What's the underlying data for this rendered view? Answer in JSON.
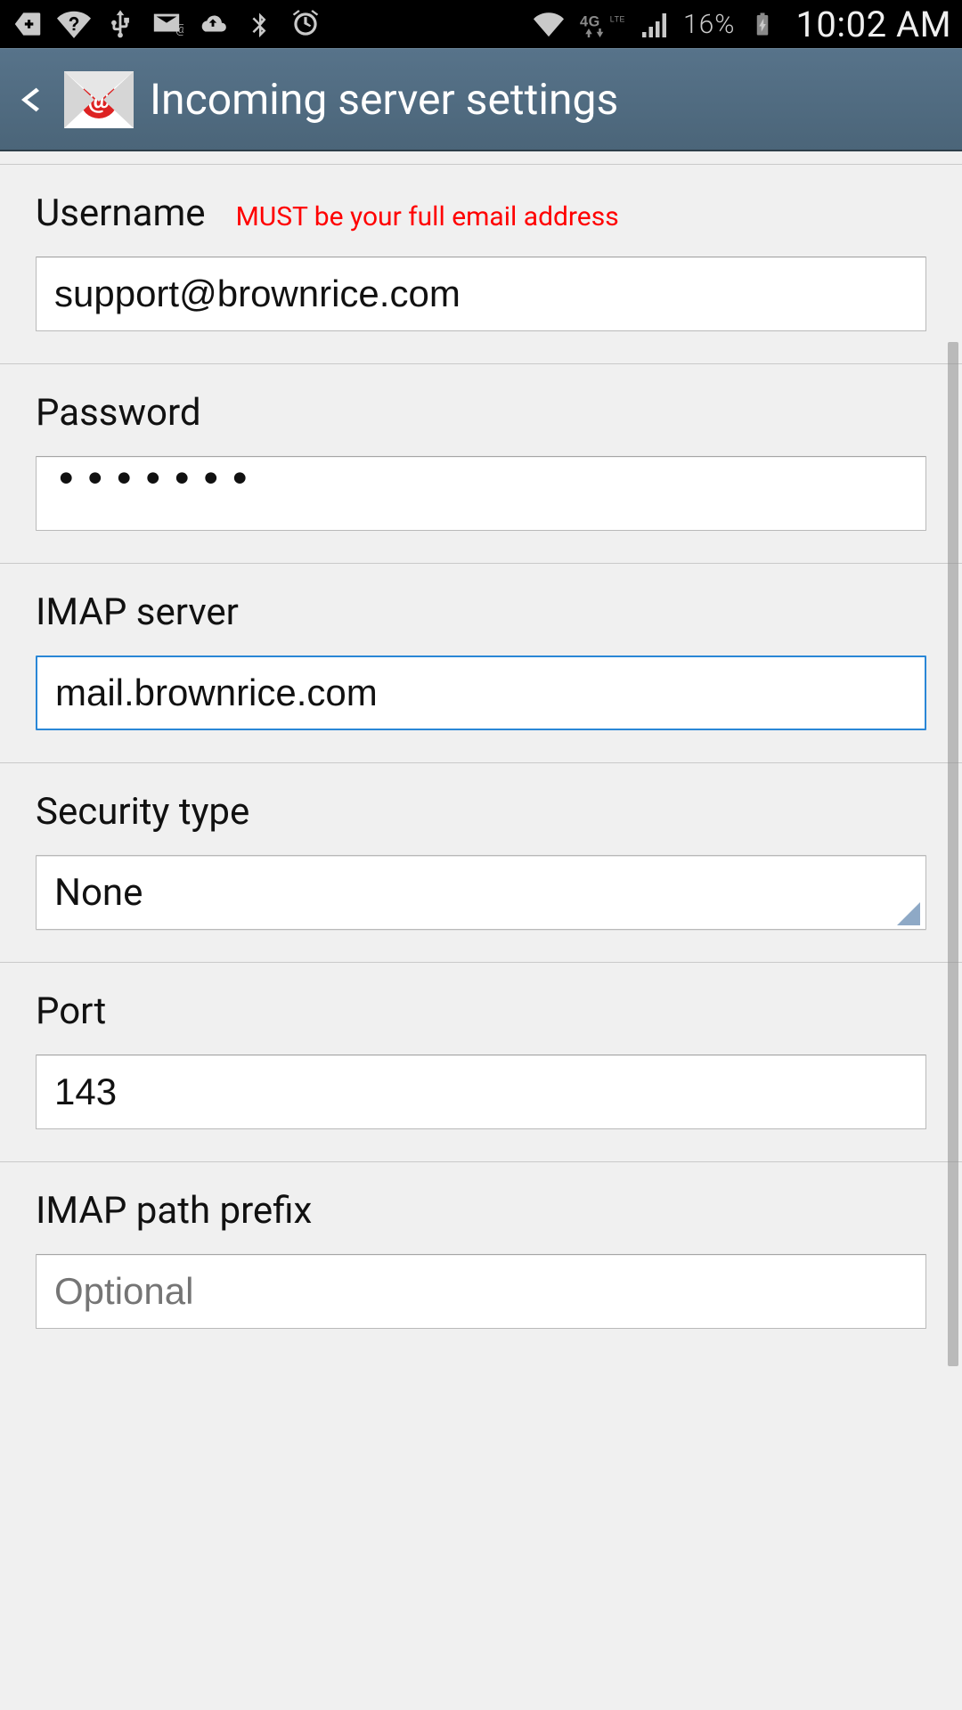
{
  "status": {
    "battery_pct": "16%",
    "clock": "10:02 AM"
  },
  "header": {
    "title": "Incoming server settings"
  },
  "form": {
    "username": {
      "label": "Username",
      "hint": "MUST be your full email address",
      "value": "support@brownrice.com"
    },
    "password": {
      "label": "Password",
      "value": "•••••••"
    },
    "imap_server": {
      "label": "IMAP server",
      "value": "mail.brownrice.com"
    },
    "security_type": {
      "label": "Security type",
      "value": "None"
    },
    "port": {
      "label": "Port",
      "value": "143"
    },
    "imap_path_prefix": {
      "label": "IMAP path prefix",
      "placeholder": "Optional",
      "value": ""
    }
  }
}
